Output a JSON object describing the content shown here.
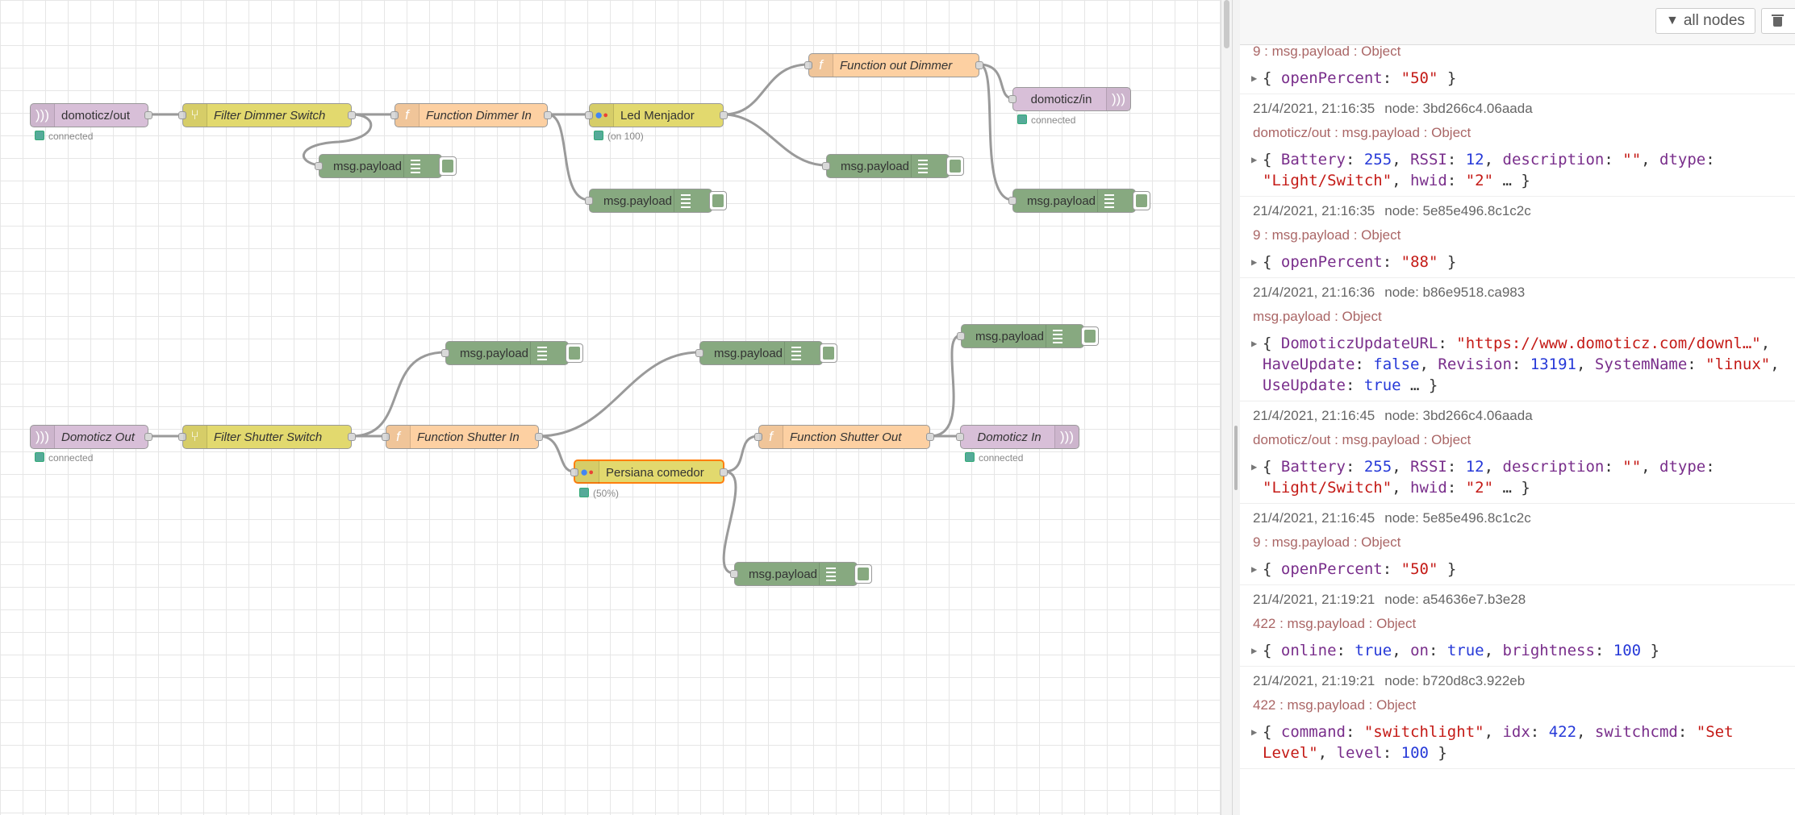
{
  "flow": {
    "nodes": {
      "mqtt_out_1": {
        "label": "domoticz/out",
        "status": "connected"
      },
      "filter_dimmer": {
        "label": "Filter Dimmer Switch"
      },
      "func_dimmer_in": {
        "label": "Function Dimmer In"
      },
      "ga_led": {
        "label": "Led Menjador",
        "status": "(on 100)"
      },
      "func_dimmer_out": {
        "label": "Function out Dimmer"
      },
      "mqtt_in_1": {
        "label": "domoticz/in",
        "status": "connected"
      },
      "mqtt_out_2": {
        "label": "Domoticz Out",
        "status": "connected"
      },
      "filter_shutter": {
        "label": "Filter Shutter Switch"
      },
      "func_shutter_in": {
        "label": "Function Shutter In"
      },
      "ga_persiana": {
        "label": "Persiana comedor",
        "status": "(50%)"
      },
      "func_shutter_out": {
        "label": "Function Shutter Out"
      },
      "mqtt_in_2": {
        "label": "Domoticz In",
        "status": "connected"
      },
      "debug_label": "msg.payload"
    }
  },
  "sidebar": {
    "filter_label": "all nodes",
    "messages": [
      {
        "meta": "",
        "node": "",
        "topic": "9 : msg.payload : Object",
        "payload": [
          [
            [
              "p",
              "{ "
            ],
            [
              "k",
              "openPercent"
            ],
            [
              "p",
              ": "
            ],
            [
              "s",
              "\"50\""
            ],
            [
              "p",
              " }"
            ]
          ]
        ]
      },
      {
        "meta": "21/4/2021, 21:16:35",
        "node": "node: 3bd266c4.06aada",
        "topic": "domoticz/out : msg.payload : Object",
        "payload": [
          [
            [
              "p",
              "{ "
            ],
            [
              "k",
              "Battery"
            ],
            [
              "p",
              ": "
            ],
            [
              "n",
              "255"
            ],
            [
              "p",
              ", "
            ],
            [
              "k",
              "RSSI"
            ],
            [
              "p",
              ": "
            ],
            [
              "n",
              "12"
            ],
            [
              "p",
              ", "
            ],
            [
              "k",
              "description"
            ],
            [
              "p",
              ": "
            ],
            [
              "s",
              "\"\""
            ],
            [
              "p",
              ", "
            ],
            [
              "k",
              "dtype"
            ],
            [
              "p",
              ":"
            ]
          ],
          [
            [
              "s",
              "\"Light/Switch\""
            ],
            [
              "p",
              ", "
            ],
            [
              "k",
              "hwid"
            ],
            [
              "p",
              ": "
            ],
            [
              "s",
              "\"2\""
            ],
            [
              "p",
              " … }"
            ]
          ]
        ]
      },
      {
        "meta": "21/4/2021, 21:16:35",
        "node": "node: 5e85e496.8c1c2c",
        "topic": "9 : msg.payload : Object",
        "payload": [
          [
            [
              "p",
              "{ "
            ],
            [
              "k",
              "openPercent"
            ],
            [
              "p",
              ": "
            ],
            [
              "s",
              "\"88\""
            ],
            [
              "p",
              " }"
            ]
          ]
        ]
      },
      {
        "meta": "21/4/2021, 21:16:36",
        "node": "node: b86e9518.ca983",
        "topic": "msg.payload : Object",
        "payload": [
          [
            [
              "p",
              "{ "
            ],
            [
              "k",
              "DomoticzUpdateURL"
            ],
            [
              "p",
              ": "
            ],
            [
              "s",
              "\"https://www.domoticz.com/downl…\""
            ],
            [
              "p",
              ","
            ]
          ],
          [
            [
              "k",
              "HaveUpdate"
            ],
            [
              "p",
              ": "
            ],
            [
              "b",
              "false"
            ],
            [
              "p",
              ", "
            ],
            [
              "k",
              "Revision"
            ],
            [
              "p",
              ": "
            ],
            [
              "n",
              "13191"
            ],
            [
              "p",
              ", "
            ],
            [
              "k",
              "SystemName"
            ],
            [
              "p",
              ": "
            ],
            [
              "s",
              "\"linux\""
            ],
            [
              "p",
              ","
            ]
          ],
          [
            [
              "k",
              "UseUpdate"
            ],
            [
              "p",
              ": "
            ],
            [
              "b",
              "true"
            ],
            [
              "p",
              " … }"
            ]
          ]
        ]
      },
      {
        "meta": "21/4/2021, 21:16:45",
        "node": "node: 3bd266c4.06aada",
        "topic": "domoticz/out : msg.payload : Object",
        "payload": [
          [
            [
              "p",
              "{ "
            ],
            [
              "k",
              "Battery"
            ],
            [
              "p",
              ": "
            ],
            [
              "n",
              "255"
            ],
            [
              "p",
              ", "
            ],
            [
              "k",
              "RSSI"
            ],
            [
              "p",
              ": "
            ],
            [
              "n",
              "12"
            ],
            [
              "p",
              ", "
            ],
            [
              "k",
              "description"
            ],
            [
              "p",
              ": "
            ],
            [
              "s",
              "\"\""
            ],
            [
              "p",
              ", "
            ],
            [
              "k",
              "dtype"
            ],
            [
              "p",
              ":"
            ]
          ],
          [
            [
              "s",
              "\"Light/Switch\""
            ],
            [
              "p",
              ", "
            ],
            [
              "k",
              "hwid"
            ],
            [
              "p",
              ": "
            ],
            [
              "s",
              "\"2\""
            ],
            [
              "p",
              " … }"
            ]
          ]
        ]
      },
      {
        "meta": "21/4/2021, 21:16:45",
        "node": "node: 5e85e496.8c1c2c",
        "topic": "9 : msg.payload : Object",
        "payload": [
          [
            [
              "p",
              "{ "
            ],
            [
              "k",
              "openPercent"
            ],
            [
              "p",
              ": "
            ],
            [
              "s",
              "\"50\""
            ],
            [
              "p",
              " }"
            ]
          ]
        ]
      },
      {
        "meta": "21/4/2021, 21:19:21",
        "node": "node: a54636e7.b3e28",
        "topic": "422 : msg.payload : Object",
        "payload": [
          [
            [
              "p",
              "{ "
            ],
            [
              "k",
              "online"
            ],
            [
              "p",
              ": "
            ],
            [
              "b",
              "true"
            ],
            [
              "p",
              ", "
            ],
            [
              "k",
              "on"
            ],
            [
              "p",
              ": "
            ],
            [
              "b",
              "true"
            ],
            [
              "p",
              ", "
            ],
            [
              "k",
              "brightness"
            ],
            [
              "p",
              ": "
            ],
            [
              "n",
              "100"
            ],
            [
              "p",
              " }"
            ]
          ]
        ]
      },
      {
        "meta": "21/4/2021, 21:19:21",
        "node": "node: b720d8c3.922eb",
        "topic": "422 : msg.payload : Object",
        "payload": [
          [
            [
              "p",
              "{ "
            ],
            [
              "k",
              "command"
            ],
            [
              "p",
              ": "
            ],
            [
              "s",
              "\"switchlight\""
            ],
            [
              "p",
              ", "
            ],
            [
              "k",
              "idx"
            ],
            [
              "p",
              ": "
            ],
            [
              "n",
              "422"
            ],
            [
              "p",
              ", "
            ],
            [
              "k",
              "switchcmd"
            ],
            [
              "p",
              ": "
            ],
            [
              "s",
              "\"Set"
            ]
          ],
          [
            [
              "s",
              "Level\""
            ],
            [
              "p",
              ", "
            ],
            [
              "k",
              "level"
            ],
            [
              "p",
              ": "
            ],
            [
              "n",
              "100"
            ],
            [
              "p",
              " }"
            ]
          ]
        ]
      }
    ]
  }
}
